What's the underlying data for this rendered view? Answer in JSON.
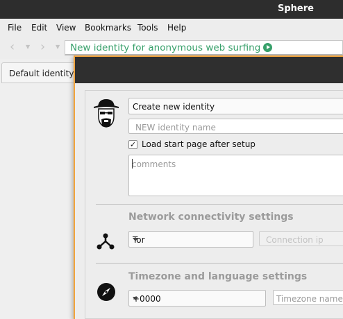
{
  "window": {
    "title": "Sphere"
  },
  "menu": [
    {
      "label": "File"
    },
    {
      "label": "Edit"
    },
    {
      "label": "View"
    },
    {
      "label": "Bookmarks"
    },
    {
      "label": "Tools"
    },
    {
      "label": "Help"
    }
  ],
  "nav": {
    "back_icon": "back-arrow-icon",
    "forward_icon": "forward-arrow-icon",
    "url_text": "New identity for anonymous web surfing",
    "go_icon": "play-go-icon",
    "accent": "#37a06a"
  },
  "tabs": [
    {
      "label": "Default identity"
    }
  ],
  "dialog": {
    "border_color": "#f2a43c",
    "identity": {
      "icon": "heisenberg-avatar-icon",
      "mode_select": "Create new identity",
      "name_placeholder": "NEW identity name",
      "load_start_checked": true,
      "load_start_label": "Load start page after setup",
      "comments_placeholder": "comments"
    },
    "network": {
      "title": "Network connectivity settings",
      "icon": "network-tree-icon",
      "type_select": "Tor",
      "ip_placeholder": "Connection ip"
    },
    "timezone": {
      "title": "Timezone and language settings",
      "icon": "compass-icon",
      "offset_select": "+0000",
      "name_placeholder": "Timezone name"
    }
  }
}
